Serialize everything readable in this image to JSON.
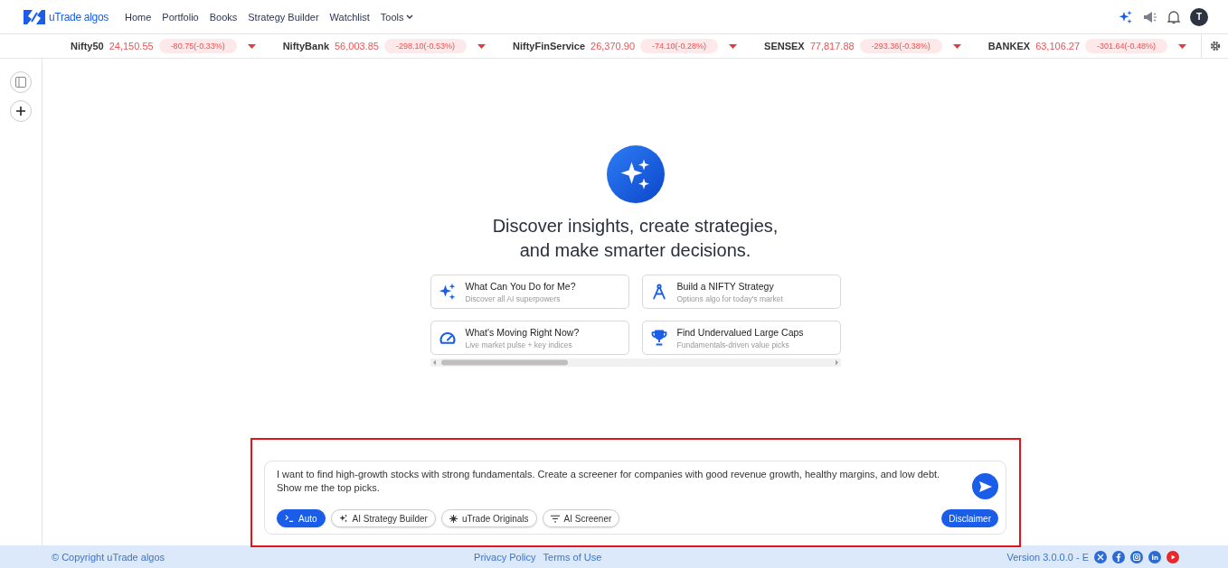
{
  "header": {
    "logo_text": "uTrade algos",
    "nav": [
      {
        "label": "Home",
        "dropdown": false
      },
      {
        "label": "Portfolio",
        "dropdown": false
      },
      {
        "label": "Books",
        "dropdown": false
      },
      {
        "label": "Strategy Builder",
        "dropdown": false
      },
      {
        "label": "Watchlist",
        "dropdown": false
      },
      {
        "label": "Tools",
        "dropdown": true
      }
    ],
    "avatar": "T"
  },
  "ticker": [
    {
      "name": "Nifty50",
      "value": "24,150.55",
      "change": "-80.75(-0.33%)"
    },
    {
      "name": "NiftyBank",
      "value": "56,003.85",
      "change": "-298.10(-0.53%)"
    },
    {
      "name": "NiftyFinService",
      "value": "26,370.90",
      "change": "-74.10(-0.28%)"
    },
    {
      "name": "SENSEX",
      "value": "77,817.88",
      "change": "-293.36(-0.38%)"
    },
    {
      "name": "BANKEX",
      "value": "63,106.27",
      "change": "-301.64(-0.48%)"
    }
  ],
  "hero": {
    "heading_lines": [
      "Discover insights, create strategies,",
      "and make smarter decisions."
    ]
  },
  "suggestions": [
    {
      "kind": "sparkle",
      "title": "What Can You Do for Me?",
      "subtitle": "Discover all AI superpowers"
    },
    {
      "kind": "compass",
      "title": "Build a NIFTY Strategy",
      "subtitle": "Options algo for today's market"
    },
    {
      "kind": "gauge",
      "title": "What's Moving Right Now?",
      "subtitle": "Live market pulse + key indices"
    },
    {
      "kind": "trophy",
      "title": "Find Undervalued Large Caps",
      "subtitle": "Fundamentals-driven value picks"
    }
  ],
  "prompt": {
    "value": "I want to find high-growth stocks with strong fundamentals. Create a screener for companies with good revenue growth, healthy margins, and low debt. Show me the top picks.",
    "modes": [
      {
        "kind": "terminal",
        "label": "Auto",
        "selected": true
      },
      {
        "kind": "sparkle",
        "label": "AI Strategy Builder",
        "selected": false
      },
      {
        "kind": "burst",
        "label": "uTrade Originals",
        "selected": false
      },
      {
        "kind": "filter",
        "label": "AI Screener",
        "selected": false
      }
    ],
    "disclaimer": "Disclaimer"
  },
  "footer": {
    "copyright": "© Copyright uTrade algos",
    "links": [
      "Privacy Policy",
      "Terms of Use"
    ],
    "version": "Version 3.0.0.0 - E",
    "social": [
      {
        "kind": "x"
      },
      {
        "kind": "facebook"
      },
      {
        "kind": "instagram"
      },
      {
        "kind": "linkedin"
      },
      {
        "kind": "youtube"
      }
    ]
  }
}
